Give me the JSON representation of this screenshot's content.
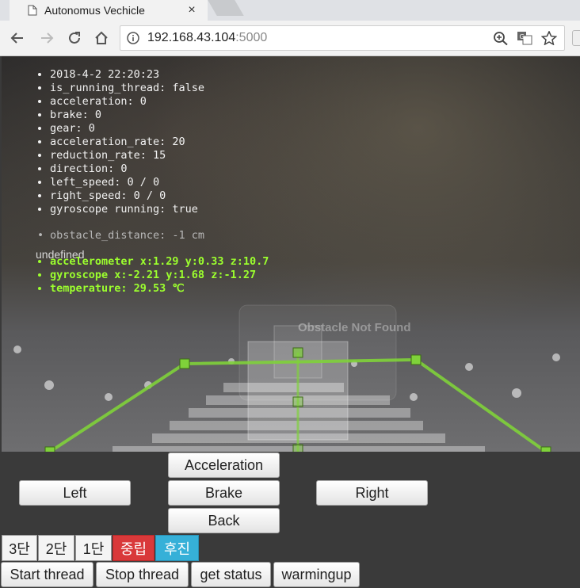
{
  "browser": {
    "tab_title": "Autonomus Vechicle",
    "tab_close": "×",
    "url_host": "192.168.43.104",
    "url_port": ":5000"
  },
  "status": {
    "items": [
      "2018-4-2 22:20:23",
      "is_running_thread: false",
      "acceleration: 0",
      "brake: 0",
      "gear: 0",
      "acceleration_rate: 20",
      "reduction_rate: 15",
      "direction: 0",
      "left_speed: 0 / 0",
      "right_speed: 0 / 0",
      "gyroscope running: true"
    ],
    "obstacle_distance": "obstacle_distance: -1 cm",
    "undefined_text": "undefined",
    "sensors": [
      "accelerometer x:1.29 y:0.33 z:10.7",
      "gyroscope x:-2.21 y:1.68 z:-1.27",
      "temperature: 29.53 ℃"
    ],
    "obstacle_overlay": "Obstacle Not Found"
  },
  "controls": {
    "acceleration": "Acceleration",
    "left": "Left",
    "brake": "Brake",
    "right": "Right",
    "back": "Back"
  },
  "gears": {
    "g3": "3단",
    "g2": "2단",
    "g1": "1단",
    "neutral": "중립",
    "reverse": "후진",
    "neutral_color": "#d9393a",
    "reverse_color": "#36b0d8"
  },
  "actions": {
    "start": "Start thread",
    "stop": "Stop thread",
    "status": "get status",
    "warmup": "warmingup"
  },
  "overlay_color": "#7fd23a"
}
